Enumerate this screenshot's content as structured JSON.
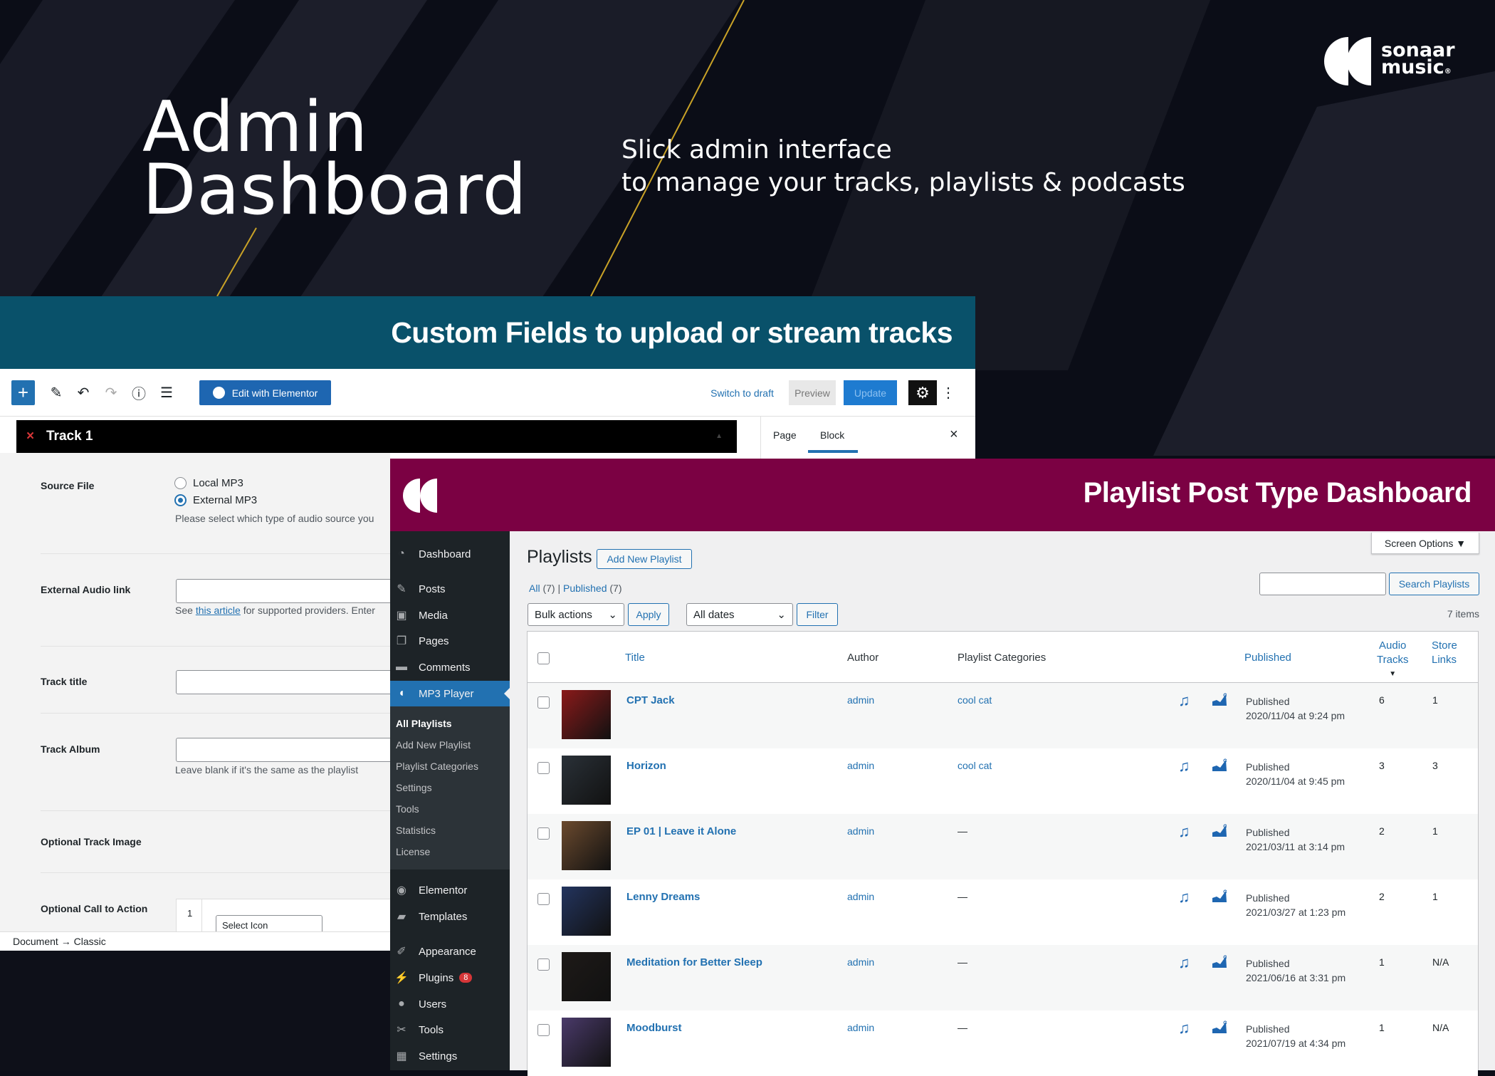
{
  "hero": {
    "title_line1": "Admin",
    "title_line2": "Dashboard",
    "subtitle_line1": "Slick admin interface",
    "subtitle_line2": "to manage your tracks, playlists & podcasts"
  },
  "brand": {
    "line1": "sonaar",
    "line2": "music",
    "mark": "®"
  },
  "banners": {
    "custom_fields": "Custom Fields to upload or stream tracks",
    "playlist_dashboard": "Playlist Post Type Dashboard"
  },
  "colors": {
    "teal": "#09516a",
    "maroon": "#7b0143",
    "wp_blue": "#2271b1",
    "sidebar": "#1d2327",
    "accent_gold": "#c9a227"
  },
  "editor": {
    "toolbar": {
      "add": "+",
      "edit_elementor": "Edit with Elementor",
      "switch_draft": "Switch to draft",
      "preview": "Preview",
      "update": "Update"
    },
    "track_header": {
      "close": "×",
      "title": "Track 1",
      "toggle": "▲"
    },
    "panel_tabs": {
      "page": "Page",
      "block": "Block",
      "close": "×"
    },
    "fields": {
      "source_file": "Source File",
      "local_mp3": "Local MP3",
      "external_mp3": "External MP3",
      "source_help": "Please select which type of audio source you",
      "external_link": "External Audio link",
      "link_help_pre": "See ",
      "link_help_link": "this article",
      "link_help_post": " for supported providers. Enter",
      "track_title": "Track title",
      "track_album": "Track Album",
      "album_help": "Leave blank if it's the same as the playlist",
      "track_image": "Optional Track Image",
      "cta": "Optional Call to Action",
      "cta_index": "1",
      "cta_select": "Select Icon"
    },
    "breadcrumb": {
      "doc": "Document",
      "arrow": "→",
      "classic": "Classic"
    }
  },
  "sidebar": {
    "items": [
      {
        "label": "Dashboard",
        "icon": "dashboard-icon"
      },
      {
        "label": "Posts",
        "icon": "pin-icon"
      },
      {
        "label": "Media",
        "icon": "media-icon"
      },
      {
        "label": "Pages",
        "icon": "pages-icon"
      },
      {
        "label": "Comments",
        "icon": "comment-icon"
      },
      {
        "label": "MP3 Player",
        "icon": "sonaar-icon",
        "active": true
      },
      {
        "label": "Elementor",
        "icon": "elementor-icon"
      },
      {
        "label": "Templates",
        "icon": "folder-icon"
      },
      {
        "label": "Appearance",
        "icon": "brush-icon"
      },
      {
        "label": "Plugins",
        "icon": "plugin-icon",
        "badge": "8"
      },
      {
        "label": "Users",
        "icon": "user-icon"
      },
      {
        "label": "Tools",
        "icon": "wrench-icon"
      },
      {
        "label": "Settings",
        "icon": "settings-icon"
      }
    ],
    "submenu": [
      "All Playlists",
      "Add New Playlist",
      "Playlist Categories",
      "Settings",
      "Tools",
      "Statistics",
      "License"
    ]
  },
  "main": {
    "screen_options": "Screen Options ▼",
    "page_title": "Playlists",
    "add_new": "Add New Playlist",
    "filters": {
      "all": "All",
      "all_count": "(7)",
      "sep": "|",
      "published": "Published",
      "published_count": "(7)"
    },
    "search_button": "Search Playlists",
    "search_value": "",
    "bulk_actions": "Bulk actions",
    "apply": "Apply",
    "all_dates": "All dates",
    "filter": "Filter",
    "items_count": "7 items",
    "columns": {
      "title": "Title",
      "author": "Author",
      "categories": "Playlist Categories",
      "published": "Published",
      "audio_tracks_1": "Audio",
      "audio_tracks_2": "Tracks",
      "sort": "▼",
      "store_links_1": "Store",
      "store_links_2": "Links"
    },
    "rows": [
      {
        "title": "CPT Jack",
        "author": "admin",
        "category": "cool cat",
        "status": "Published",
        "date": "2020/11/04 at 9:24 pm",
        "tracks": "6",
        "links": "1",
        "art": "#8a1a1a"
      },
      {
        "title": "Horizon",
        "author": "admin",
        "category": "cool cat",
        "status": "Published",
        "date": "2020/11/04 at 9:45 pm",
        "tracks": "3",
        "links": "3",
        "art": "#2a3138"
      },
      {
        "title": "EP 01 | Leave it Alone",
        "author": "admin",
        "category": "—",
        "status": "Published",
        "date": "2021/03/11 at 3:14 pm",
        "tracks": "2",
        "links": "1",
        "art": "#6b4a2e"
      },
      {
        "title": "Lenny Dreams",
        "author": "admin",
        "category": "—",
        "status": "Published",
        "date": "2021/03/27 at 1:23 pm",
        "tracks": "2",
        "links": "1",
        "art": "#23345e"
      },
      {
        "title": "Meditation for Better Sleep",
        "author": "admin",
        "category": "—",
        "status": "Published",
        "date": "2021/06/16 at 3:31 pm",
        "tracks": "1",
        "links": "N/A",
        "art": "#1e1a18"
      },
      {
        "title": "Moodburst",
        "author": "admin",
        "category": "—",
        "status": "Published",
        "date": "2021/07/19 at 4:34 pm",
        "tracks": "1",
        "links": "N/A",
        "art": "#4a3a6a"
      }
    ]
  }
}
